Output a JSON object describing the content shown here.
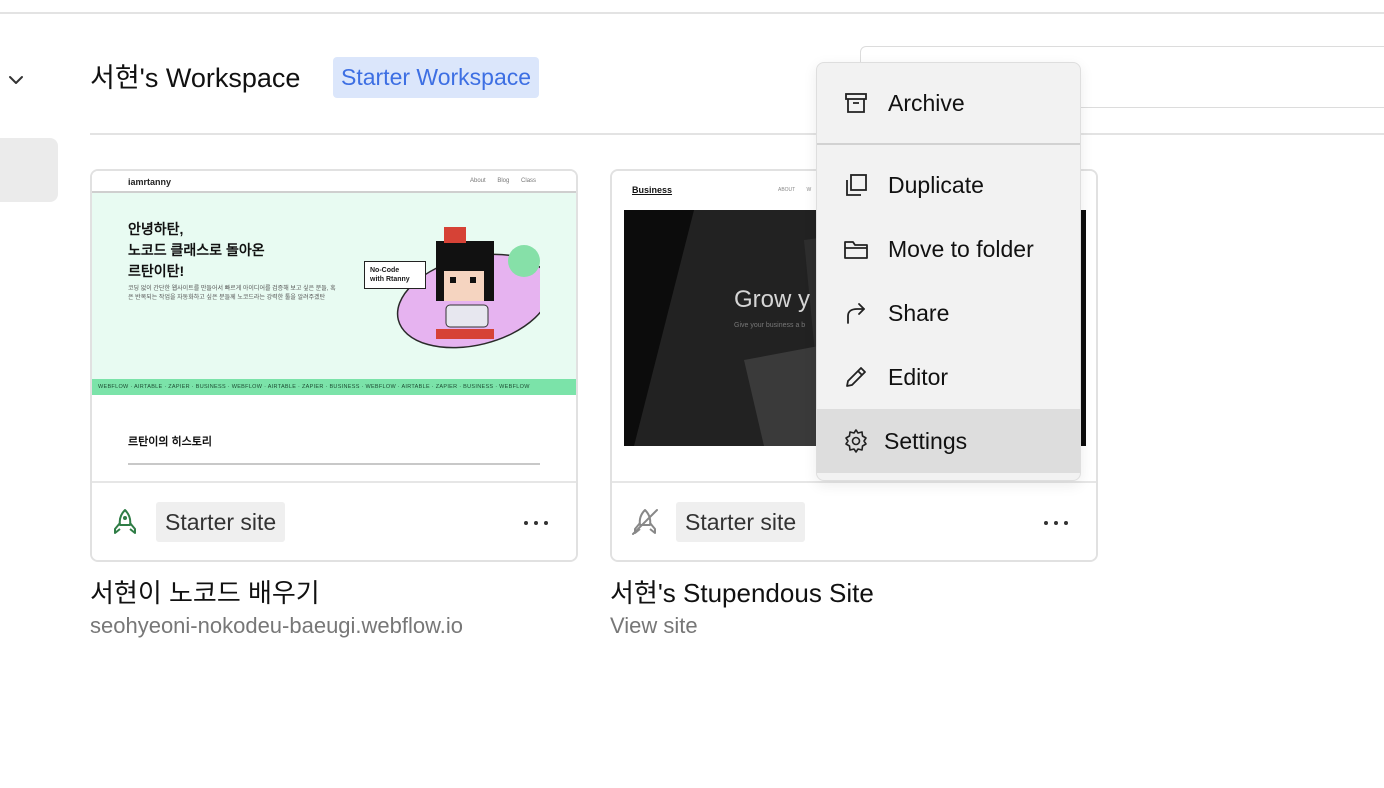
{
  "workspace": {
    "title": "서현's Workspace",
    "badge": "Starter Workspace"
  },
  "sites": [
    {
      "name": "서현이 노코드 배우기",
      "url": "seohyeoni-nokodeu-baeugi.webflow.io",
      "plan": "Starter site",
      "status_icon": "rocket-icon",
      "thumbnail": {
        "logo": "iamrtanny",
        "nav_links": "About Blog Class",
        "headline": [
          "안녕하탄,",
          "노코드 클래스로 돌아온",
          "르탄이탄!"
        ],
        "body": "코딩 없이 간단한 웹사이트를 만들어서 빠르게 아이디어를 검증해 보고 싶은 분들, 혹은 반복되는 작업을 자동화하고 싶은 분들께 노코드라는 강력한 툴을 알려주겠탄",
        "bubble": [
          "No-Code",
          "with Rtanny"
        ],
        "marquee": "WEBFLOW · AIRTABLE · ZAPIER · BUSINESS · WEBFLOW · AIRTABLE · ZAPIER · BUSINESS · WEBFLOW · AIRTABLE · ZAPIER · BUSINESS · WEBFLOW",
        "section_title": "르탄이의 히스토리"
      }
    },
    {
      "name": "서현's Stupendous Site",
      "url": "View site",
      "plan": "Starter site",
      "status_icon": "rocket-off-icon",
      "thumbnail": {
        "logo": "Business",
        "nav_links": "ABOUT W",
        "hero_title": "Grow y",
        "hero_sub": "Give your business a b"
      }
    }
  ],
  "context_menu": {
    "items": [
      {
        "label": "Archive",
        "icon": "archive-icon"
      },
      {
        "label": "Duplicate",
        "icon": "duplicate-icon"
      },
      {
        "label": "Move to folder",
        "icon": "folder-icon"
      },
      {
        "label": "Share",
        "icon": "share-icon"
      },
      {
        "label": "Editor",
        "icon": "pencil-icon"
      },
      {
        "label": "Settings",
        "icon": "gear-icon",
        "highlighted": true
      }
    ]
  },
  "colors": {
    "badge_bg": "#dbe6fb",
    "badge_text": "#3d6fe3",
    "published_icon": "#2f7d46",
    "menu_bg": "#f2f2f2",
    "menu_highlight": "#dddddd"
  }
}
